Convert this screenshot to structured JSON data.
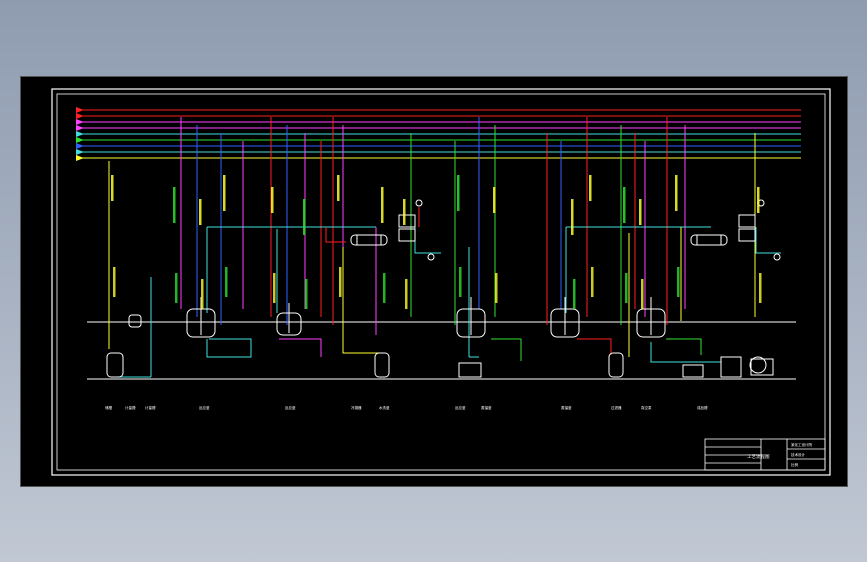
{
  "title_block": {
    "drawing_title": "工艺流程图",
    "company": "某化工设计院",
    "stage": "技术设计",
    "scale": "比例"
  },
  "equipment_labels": [
    "储槽",
    "计量槽",
    "计量槽",
    "反应釜",
    "反应釜",
    "冷凝器",
    "水洗釜",
    "反应釜",
    "蒸馏釜",
    "蒸馏釜",
    "过滤器",
    "真空泵",
    "成品槽"
  ],
  "colors": {
    "steam": "#ff2020",
    "vacuum": "#ff40ff",
    "water": "#40e0e0",
    "air": "#ffff30",
    "nitrogen": "#30e030",
    "brine": "#3060ff",
    "frame": "#ffffff"
  }
}
